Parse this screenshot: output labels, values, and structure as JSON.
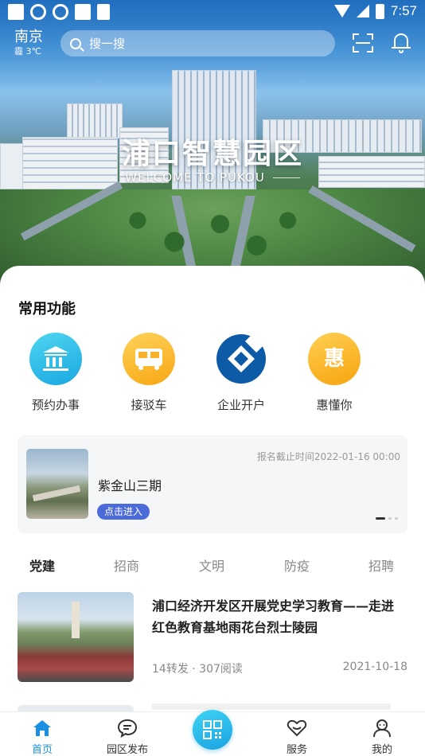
{
  "status_bar": {
    "time": "7:57"
  },
  "header": {
    "city": "南京",
    "weather": "霾 3℃",
    "search_placeholder": "搜一搜"
  },
  "hero": {
    "title": "浦口智慧园区",
    "subtitle": "WELCOME TO PUKOU"
  },
  "functions": {
    "title": "常用功能",
    "items": [
      {
        "label": "预约办事",
        "icon": "bank-icon",
        "color": "#19a7e0"
      },
      {
        "label": "接驳车",
        "icon": "bus-icon",
        "color": "#f7a712"
      },
      {
        "label": "企业开户",
        "icon": "ccb-logo-icon",
        "color": "#0d5aa7"
      },
      {
        "label": "惠懂你",
        "icon": "hui-icon",
        "glyph": "惠",
        "color": "#f7a40f"
      }
    ]
  },
  "banner": {
    "deadline": "报名截止时间2022-01-16 00:00",
    "title": "紫金山三期",
    "button": "点击进入"
  },
  "tabs": [
    "党建",
    "招商",
    "文明",
    "防疫",
    "招聘"
  ],
  "news": [
    {
      "title": "浦口经济开发区开展党史学习教育——走进红色教育基地雨花台烈士陵园",
      "meta": "14转发 · 307阅读",
      "date": "2021-10-18"
    }
  ],
  "bottom_nav": [
    "首页",
    "园区发布",
    "服务",
    "我的"
  ],
  "colors": {
    "accent": "#1a8fe3",
    "button": "#4b6bd8"
  }
}
